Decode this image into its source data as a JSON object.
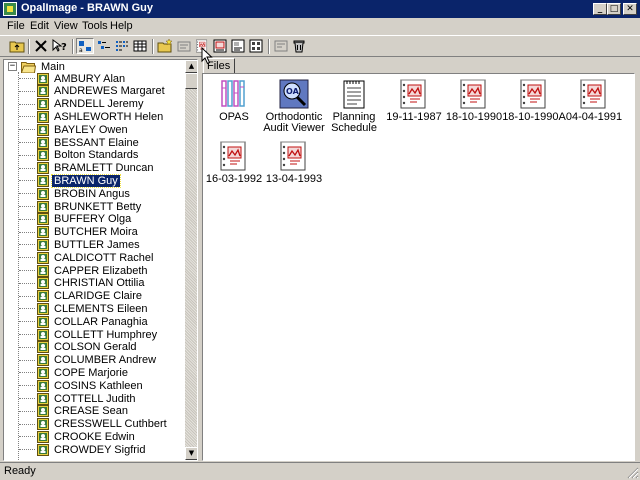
{
  "window": {
    "title": "OpalImage - BRAWN Guy"
  },
  "menu": [
    "File",
    "Edit",
    "View",
    "Tools",
    "Help"
  ],
  "tree": {
    "root_label": "Main",
    "items": [
      "AMBURY Alan",
      "ANDREWES Margaret",
      "ARNDELL Jeremy",
      "ASHLEWORTH Helen",
      "BAYLEY Owen",
      "BESSANT Elaine",
      "Bolton Standards",
      "BRAMLETT Duncan",
      "BRAWN Guy",
      "BROBIN Angus",
      "BRUNKETT Betty",
      "BUFFERY Olga",
      "BUTCHER Moira",
      "BUTTLER James",
      "CALDICOTT Rachel",
      "CAPPER Elizabeth",
      "CHRISTIAN Ottilia",
      "CLARIDGE Claire",
      "CLEMENTS Eileen",
      "COLLAR Panaghia",
      "COLLETT Humphrey",
      "COLSON Gerald",
      "COLUMBER Andrew",
      "COPE Marjorie",
      "COSINS Kathleen",
      "COTTELL Judith",
      "CREASE Sean",
      "CRESSWELL Cuthbert",
      "CROOKE Edwin",
      "CROWDEY Sigfrid"
    ],
    "selected": "BRAWN Guy"
  },
  "files_tab": {
    "label": "Files"
  },
  "files": [
    {
      "label": "OPAS",
      "icon": "opas-logo-icon"
    },
    {
      "label": "Orthodontic Audit Viewer",
      "icon": "oa-viewer-icon"
    },
    {
      "label": "Planning Schedule",
      "icon": "notepad-icon"
    },
    {
      "label": "19-11-1987",
      "icon": "dated-image-icon"
    },
    {
      "label": "18-10-1990",
      "icon": "dated-image-icon"
    },
    {
      "label": "18-10-1990A",
      "icon": "dated-image-icon"
    },
    {
      "label": "04-04-1991",
      "icon": "dated-image-icon"
    },
    {
      "label": "16-03-1992",
      "icon": "dated-image-icon"
    },
    {
      "label": "13-04-1993",
      "icon": "dated-image-icon"
    }
  ],
  "status": {
    "text": "Ready"
  },
  "colors": {
    "titlebar": "#0a246a",
    "selection": "#0a246a",
    "face": "#d4d0c8"
  }
}
